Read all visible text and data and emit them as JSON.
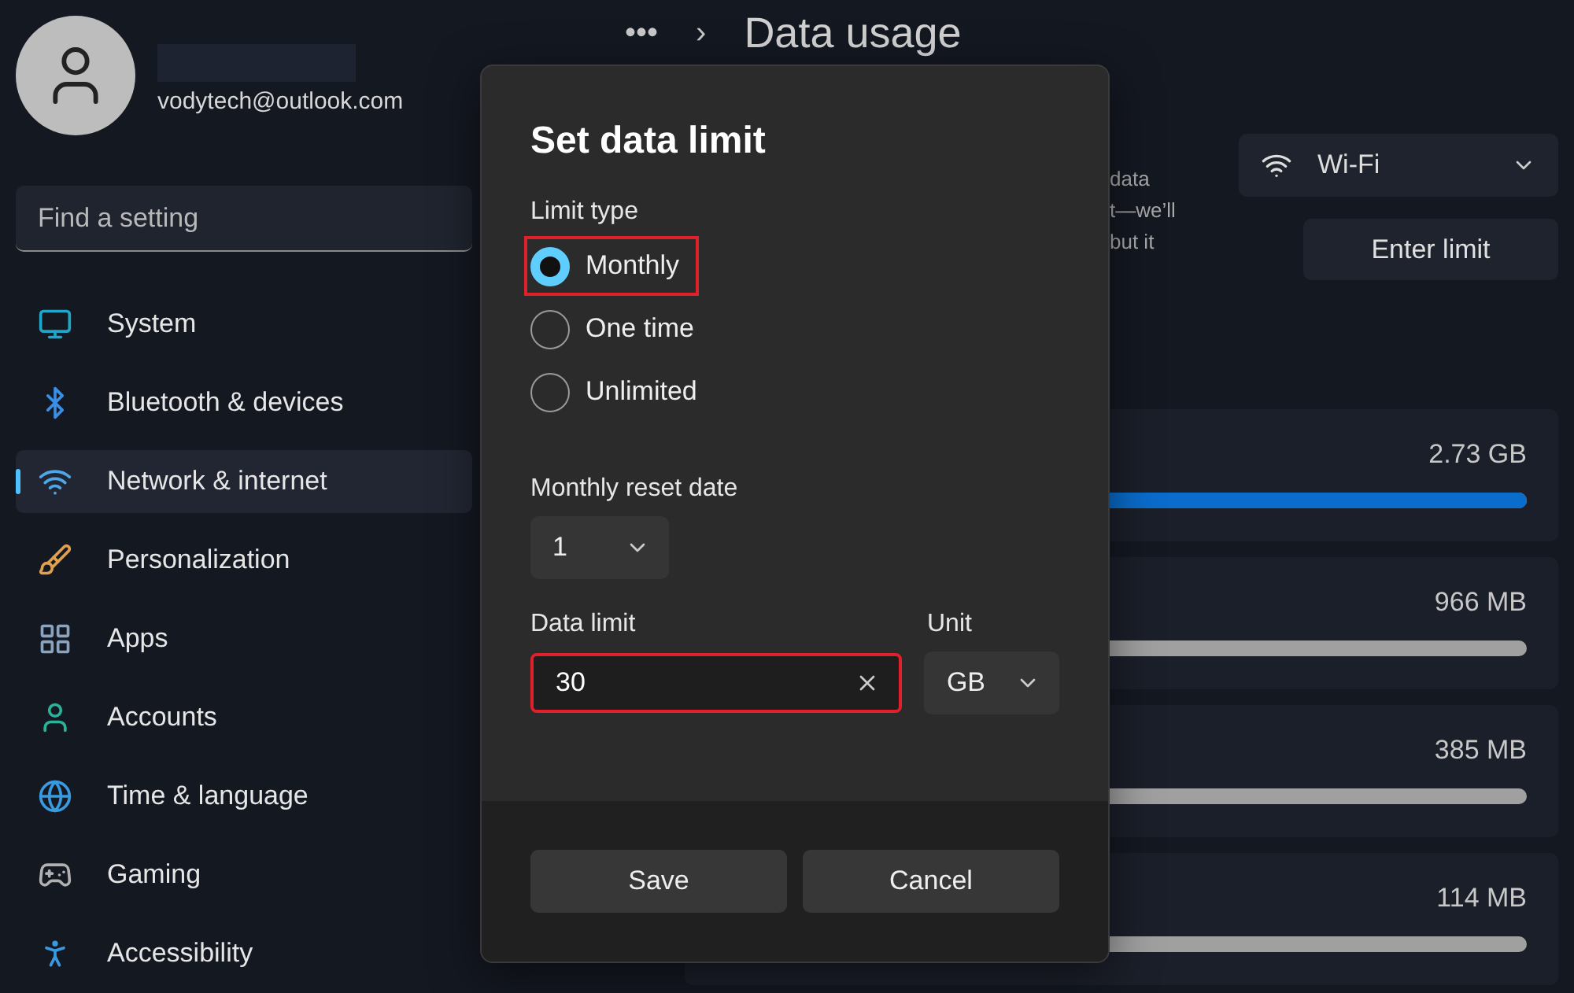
{
  "account": {
    "email": "vodytech@outlook.com"
  },
  "search": {
    "placeholder": "Find a setting"
  },
  "nav": [
    {
      "label": "System",
      "selected": false
    },
    {
      "label": "Bluetooth & devices",
      "selected": false
    },
    {
      "label": "Network & internet",
      "selected": true
    },
    {
      "label": "Personalization",
      "selected": false
    },
    {
      "label": "Apps",
      "selected": false
    },
    {
      "label": "Accounts",
      "selected": false
    },
    {
      "label": "Time & language",
      "selected": false
    },
    {
      "label": "Gaming",
      "selected": false
    },
    {
      "label": "Accessibility",
      "selected": false
    }
  ],
  "header": {
    "breadcrumb_more": "•••",
    "separator": "›",
    "title": "Data usage"
  },
  "description_fragments": [
    "data",
    "t—we’ll",
    "but it"
  ],
  "network_dropdown": {
    "value": "Wi-Fi"
  },
  "enter_limit_button": "Enter limit",
  "usage": [
    {
      "amount": "2.73 GB",
      "level": 1
    },
    {
      "amount": "966 MB"
    },
    {
      "amount": "385 MB"
    },
    {
      "amount": "114 MB"
    }
  ],
  "dialog": {
    "title": "Set data limit",
    "limit_type_label": "Limit type",
    "limit_types": [
      {
        "label": "Monthly",
        "selected": true,
        "highlighted": true
      },
      {
        "label": "One time",
        "selected": false,
        "highlighted": false
      },
      {
        "label": "Unlimited",
        "selected": false,
        "highlighted": false
      }
    ],
    "reset_date_label": "Monthly reset date",
    "reset_date": "1",
    "data_limit_label": "Data limit",
    "data_limit": {
      "value": "30",
      "highlighted": true
    },
    "unit_label": "Unit",
    "unit": "GB",
    "buttons": [
      "Save",
      "Cancel"
    ]
  }
}
